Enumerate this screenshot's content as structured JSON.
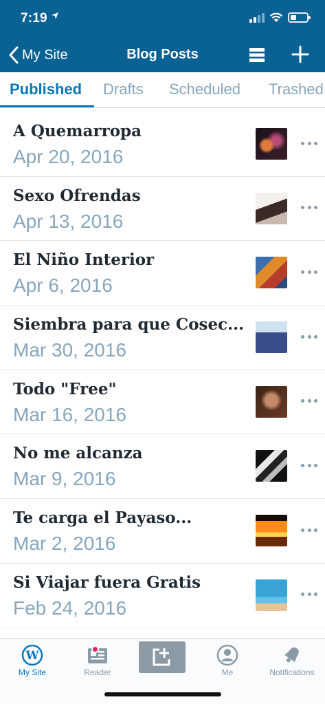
{
  "status_bar": {
    "time": "7:19",
    "battery_level": 0.35
  },
  "nav": {
    "back_label": "My Site",
    "title": "Blog Posts",
    "list_icon": "list-view-icon",
    "add_icon": "plus-icon"
  },
  "tabs": [
    {
      "label": "Published",
      "active": true
    },
    {
      "label": "Drafts",
      "active": false
    },
    {
      "label": "Scheduled",
      "active": false
    },
    {
      "label": "Trashed",
      "active": false
    }
  ],
  "posts": [
    {
      "title": "A Quemarropa",
      "date": "Apr 20, 2016"
    },
    {
      "title": "Sexo Ofrendas",
      "date": "Apr 13, 2016"
    },
    {
      "title": "El Niño Interior",
      "date": "Apr 6, 2016"
    },
    {
      "title": "Siembra para que Cosec...",
      "date": "Mar 30, 2016"
    },
    {
      "title": "Todo \"Free\"",
      "date": "Mar 16, 2016"
    },
    {
      "title": "No me alcanza",
      "date": "Mar 9, 2016"
    },
    {
      "title": "Te carga el Payaso...",
      "date": "Mar 2, 2016"
    },
    {
      "title": "Si Viajar fuera Gratis",
      "date": "Feb 24, 2016"
    }
  ],
  "bottom_tabs": [
    {
      "label": "My Site",
      "icon": "wordpress-icon",
      "active": true
    },
    {
      "label": "Reader",
      "icon": "reader-icon",
      "active": false,
      "badge": true
    },
    {
      "label": "",
      "icon": "new-post-icon",
      "active": false
    },
    {
      "label": "Me",
      "icon": "me-icon",
      "active": false
    },
    {
      "label": "Notifications",
      "icon": "bell-icon",
      "active": false
    }
  ],
  "colors": {
    "primary": "#0a6193",
    "accent": "#0a77b8",
    "muted": "#87a6bc",
    "badge": "#d8246e"
  }
}
